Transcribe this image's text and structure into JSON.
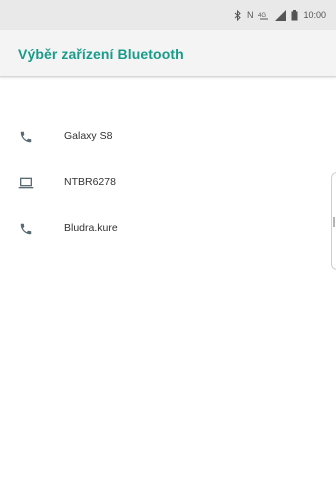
{
  "status_bar": {
    "icons": [
      "bluetooth-icon",
      "nfc-icon",
      "network-type-icon",
      "signal-icon",
      "battery-icon"
    ],
    "network_label": "N",
    "time": "10:00"
  },
  "app_bar": {
    "title": "Výběr zařízení Bluetooth",
    "title_color": "#1a9b8a"
  },
  "devices": [
    {
      "icon": "phone-icon",
      "name": "Galaxy S8"
    },
    {
      "icon": "laptop-icon",
      "name": "NTBR6278"
    },
    {
      "icon": "phone-icon",
      "name": "Bludra.kure"
    }
  ]
}
